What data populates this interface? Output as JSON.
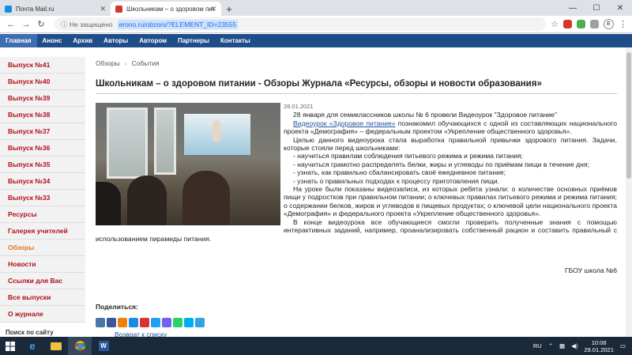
{
  "browser": {
    "tabs": [
      {
        "label": "Почта Mail.ru",
        "favicon_color": "#168de2"
      },
      {
        "label": "Школьникам – о здоровом пит",
        "favicon_color": "#d9342b"
      }
    ],
    "new_tab": "+",
    "address": {
      "security": "ⓘ Не защищено",
      "url": "erono.ru/obzors/?ELEMENT_ID=23555"
    },
    "profile_initial": "E"
  },
  "site_nav": [
    "Главная",
    "Анонс",
    "Архив",
    "Авторы",
    "Автором",
    "Партнеры",
    "Контакты"
  ],
  "sidebar": {
    "items": [
      "Выпуск №41",
      "Выпуск №40",
      "Выпуск №39",
      "Выпуск №38",
      "Выпуск №37",
      "Выпуск №36",
      "Выпуск №35",
      "Выпуск №34",
      "Выпуск №33",
      "Ресурсы",
      "Галерея учителей",
      "Обзоры",
      "Новости",
      "Ссылки для Вас",
      "Все выпуски",
      "О журнале"
    ],
    "current": "Обзоры",
    "search_label": "Поиск по сайту"
  },
  "breadcrumb": [
    "Обзоры",
    "События"
  ],
  "article": {
    "title": "Школьникам – о здоровом питании - Обзоры Журнала «Ресурсы, обзоры и новости образования»",
    "date": "28.01.2021",
    "p1": "28 января для семиклассников школы № 6 провели Видеоурок \"Здоровое питание\"",
    "p2_link": "Видеоурок «Здоровое питание»",
    "p2_rest": " познакомил обучающихся с одной из составляющих национального проекта «Демография» – федеральным проектом «Укрепление общественного здоровья».",
    "p3": "Целью данного видеоурока стала выработка правильной привычки здорового питания. Задачи, которые стояли перед школьниками:",
    "bullets": [
      "- научиться правилам соблюдения питьевого режима и режима питания;",
      "- научиться грамотно распределять белки, жиры и углеводы по приёмам пищи в течение дня;",
      "- узнать, как правильно сбалансировать своё ежедневное питание;",
      "- узнать о правильных подходах к процессу приготовления пищи."
    ],
    "p4": "На уроке были показаны видеозаписи, из которых ребята узнали: о количестве основных приёмов пищи у подростков при правильном питании; о ключевых правилах питьевого режима и режима питания; о содержании белков, жиров и углеводов в пищевых продуктах; о ключевой цели национального проекта «Демография» и федерального проекта «Укрепление общественного здоровья».",
    "p5": "В конце видеоурока все обучающиеся смогли проверить полученные знания с помощью интерактивных заданий, например, проанализировать собственный рацион и составить правильный с использованием пирамиды питания.",
    "signature": "ГБОУ школа №6"
  },
  "share": {
    "label": "Поделиться:",
    "icons": [
      {
        "name": "vk-icon",
        "color": "#4a76a8"
      },
      {
        "name": "facebook-icon",
        "color": "#3b5998"
      },
      {
        "name": "odnoklassniki-icon",
        "color": "#ee8208"
      },
      {
        "name": "mailru-icon",
        "color": "#168de2"
      },
      {
        "name": "moimir-icon",
        "color": "#d9342b"
      },
      {
        "name": "twitter-icon",
        "color": "#1da1f2"
      },
      {
        "name": "viber-icon",
        "color": "#7360f2"
      },
      {
        "name": "whatsapp-icon",
        "color": "#25d366"
      },
      {
        "name": "skype-icon",
        "color": "#00aff0"
      },
      {
        "name": "telegram-icon",
        "color": "#2ca5e0"
      }
    ],
    "back_link": "Возврат к списку"
  },
  "taskbar": {
    "lang": "RU",
    "time": "10:08",
    "date": "29.01.2021"
  }
}
